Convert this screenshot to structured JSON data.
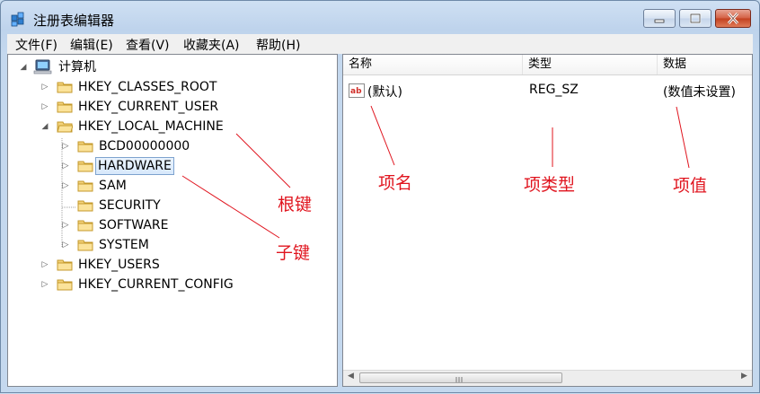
{
  "window": {
    "title": "注册表编辑器"
  },
  "menu": {
    "items": [
      "文件(F)",
      "编辑(E)",
      "查看(V)",
      "收藏夹(A)",
      "帮助(H)"
    ]
  },
  "tree": {
    "root": "计算机",
    "hkcr": "HKEY_CLASSES_ROOT",
    "hkcu": "HKEY_CURRENT_USER",
    "hklm": "HKEY_LOCAL_MACHINE",
    "bcd": "BCD00000000",
    "hardware": "HARDWARE",
    "sam": "SAM",
    "security": "SECURITY",
    "software": "SOFTWARE",
    "system": "SYSTEM",
    "hku": "HKEY_USERS",
    "hkcc": "HKEY_CURRENT_CONFIG"
  },
  "list": {
    "columns": [
      "名称",
      "类型",
      "数据"
    ],
    "rows": [
      {
        "name": "(默认)",
        "type": "REG_SZ",
        "data": "(数值未设置)"
      }
    ]
  },
  "annotations": {
    "root_key": "根键",
    "sub_key": "子键",
    "item_name": "项名",
    "item_type": "项类型",
    "item_value": "项值"
  },
  "colors": {
    "annotation": "#e0141e",
    "selection_border": "#7da2ce"
  }
}
